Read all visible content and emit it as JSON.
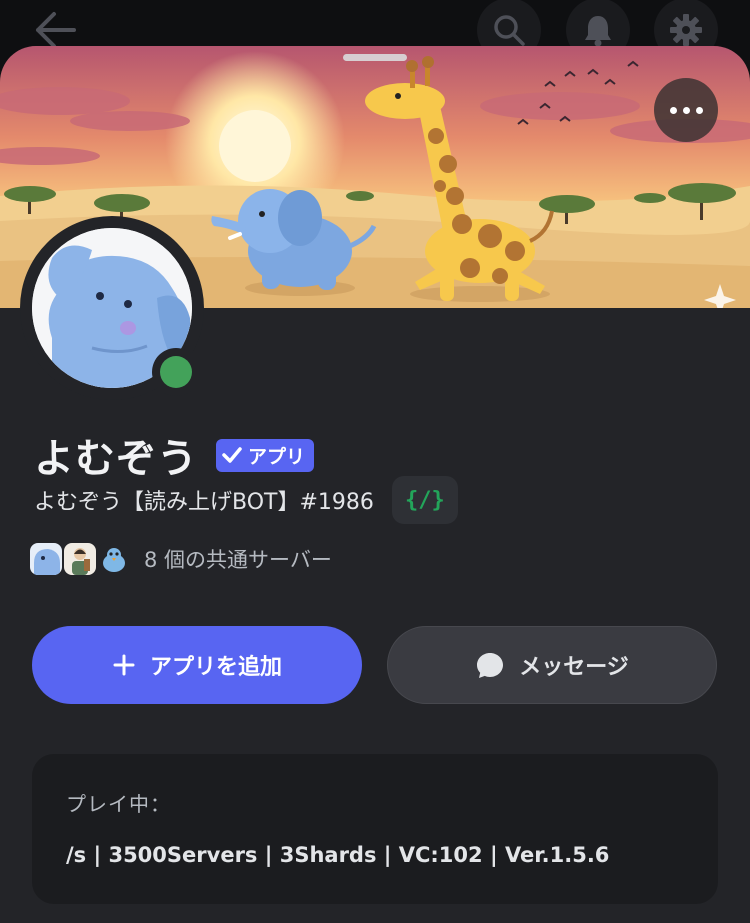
{
  "profile": {
    "display_name": "よむぞう",
    "app_badge": "アプリ",
    "username": "よむぞう【読み上げBOT】#1986",
    "command_badge": "{/}",
    "mutual_servers": "8 個の共通サーバー"
  },
  "actions": {
    "add_app": "アプリを追加",
    "message": "メッセージ"
  },
  "activity": {
    "heading": "プレイ中：",
    "state": "/s | 3500Servers | 3Shards | VC:102 | Ver.1.5.6"
  },
  "icons": [
    "back-arrow-icon",
    "search-icon",
    "bell-icon",
    "gear-icon",
    "more-icon",
    "check-icon",
    "plus-icon",
    "chat-bubble-icon",
    "sparkle-icon"
  ],
  "colors": {
    "blurple": "#5865f2",
    "online": "#43a25a",
    "surface": "#232428",
    "card": "#1b1c1f"
  }
}
